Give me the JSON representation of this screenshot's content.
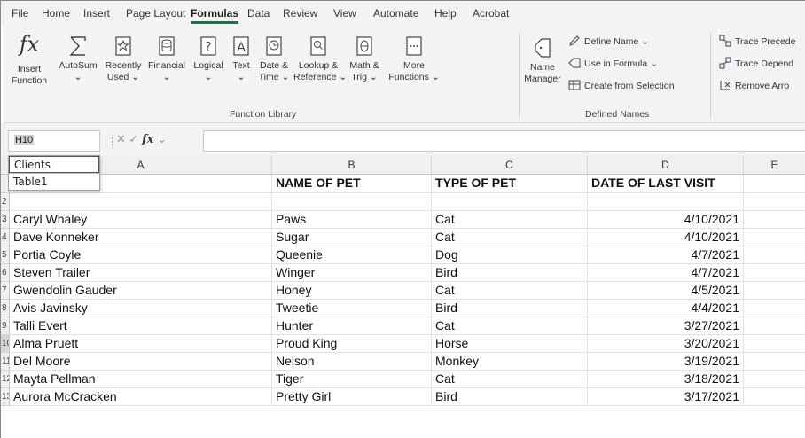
{
  "menu": {
    "tabs": [
      "File",
      "Home",
      "Insert",
      "Page Layout",
      "Formulas",
      "Data",
      "Review",
      "View",
      "Automate",
      "Help",
      "Acrobat"
    ],
    "active": "Formulas"
  },
  "ribbon": {
    "function_library": {
      "label": "Function Library",
      "insert_function": [
        "Insert",
        "Function"
      ],
      "autosum": [
        "AutoSum",
        "⌄"
      ],
      "recently_used": [
        "Recently",
        "Used ⌄"
      ],
      "financial": [
        "Financial",
        "⌄"
      ],
      "logical": [
        "Logical",
        "⌄"
      ],
      "text": [
        "Text",
        "⌄"
      ],
      "date_time": [
        "Date &",
        "Time ⌄"
      ],
      "lookup": [
        "Lookup &",
        "Reference ⌄"
      ],
      "math": [
        "Math &",
        "Trig ⌄"
      ],
      "more": [
        "More",
        "Functions ⌄"
      ]
    },
    "defined_names": {
      "label": "Defined Names",
      "name_manager": [
        "Name",
        "Manager"
      ],
      "define_name": "Define Name ⌄",
      "use_in_formula": "Use in Formula ⌄",
      "create_from_selection": "Create from Selection"
    },
    "formula_auditing": {
      "trace_precedents": "Trace Precede",
      "trace_dependents": "Trace Depend",
      "remove_arrows": "Remove Arro"
    }
  },
  "formula_bar": {
    "name_box": "H10",
    "fx_label": "fx"
  },
  "name_dropdown": {
    "items": [
      "Clients",
      "Table1"
    ]
  },
  "sheet": {
    "columns": [
      "A",
      "B",
      "C",
      "D",
      "E"
    ],
    "headers": [
      "",
      "NAME OF PET",
      "TYPE OF PET",
      "DATE OF LAST VISIT",
      ""
    ],
    "rows": [
      {
        "num": "2",
        "cells": [
          "",
          "",
          "",
          ""
        ]
      },
      {
        "num": "3",
        "cells": [
          "Caryl Whaley",
          "Paws",
          "Cat",
          "4/10/2021"
        ]
      },
      {
        "num": "4",
        "cells": [
          "Dave Konneker",
          "Sugar",
          "Cat",
          "4/10/2021"
        ]
      },
      {
        "num": "5",
        "cells": [
          "Portia Coyle",
          "Queenie",
          "Dog",
          "4/7/2021"
        ]
      },
      {
        "num": "6",
        "cells": [
          "Steven Trailer",
          "Winger",
          "Bird",
          "4/7/2021"
        ]
      },
      {
        "num": "7",
        "cells": [
          "Gwendolin Gauder",
          "Honey",
          "Cat",
          "4/5/2021"
        ]
      },
      {
        "num": "8",
        "cells": [
          "Avis Javinsky",
          "Tweetie",
          "Bird",
          "4/4/2021"
        ]
      },
      {
        "num": "9",
        "cells": [
          "Talli Evert",
          "Hunter",
          "Cat",
          "3/27/2021"
        ]
      },
      {
        "num": "10",
        "cells": [
          "Alma Pruett",
          "Proud King",
          "Horse",
          "3/20/2021"
        ]
      },
      {
        "num": "11",
        "cells": [
          "Del Moore",
          "Nelson",
          "Monkey",
          "3/19/2021"
        ]
      },
      {
        "num": "12",
        "cells": [
          "Mayta Pellman",
          "Tiger",
          "Cat",
          "3/18/2021"
        ]
      },
      {
        "num": "13",
        "cells": [
          "Aurora McCracken",
          "Pretty Girl",
          "Bird",
          "3/17/2021"
        ]
      }
    ],
    "selected_row": "10"
  },
  "colors": {
    "accent": "#217346",
    "ribbon_bg": "#f3f3f3",
    "header_bg": "#f0f0f0"
  }
}
